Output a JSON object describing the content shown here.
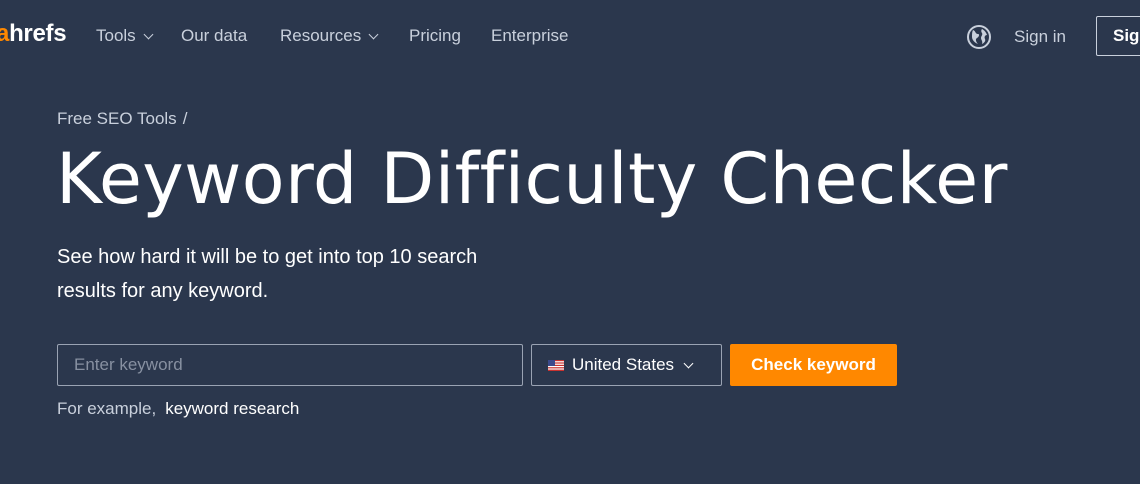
{
  "header": {
    "logo": {
      "accent": "a",
      "rest": "hrefs"
    },
    "nav": [
      {
        "label": "Tools",
        "dropdown": true
      },
      {
        "label": "Our data",
        "dropdown": false
      },
      {
        "label": "Resources",
        "dropdown": true
      },
      {
        "label": "Pricing",
        "dropdown": false
      },
      {
        "label": "Enterprise",
        "dropdown": false
      }
    ],
    "language_icon": "globe-icon",
    "signin_label": "Sign in",
    "signup_label": "Sig"
  },
  "hero": {
    "breadcrumb": {
      "link": "Free SEO Tools",
      "separator": "/"
    },
    "title": "Keyword Difficulty Checker",
    "subtitle_line1": "See how hard it will be to get into top 10 search",
    "subtitle_line2": "results for any keyword."
  },
  "form": {
    "keyword_placeholder": "Enter keyword",
    "keyword_value": "",
    "country": {
      "label": "United States",
      "flag_icon": "us-flag-icon"
    },
    "submit_label": "Check keyword",
    "example_label": "For example,",
    "example_value": "keyword research"
  },
  "colors": {
    "background": "#2b374d",
    "accent": "#ff8800",
    "muted_text": "#c9d0dc",
    "border": "#9aa3b3"
  }
}
